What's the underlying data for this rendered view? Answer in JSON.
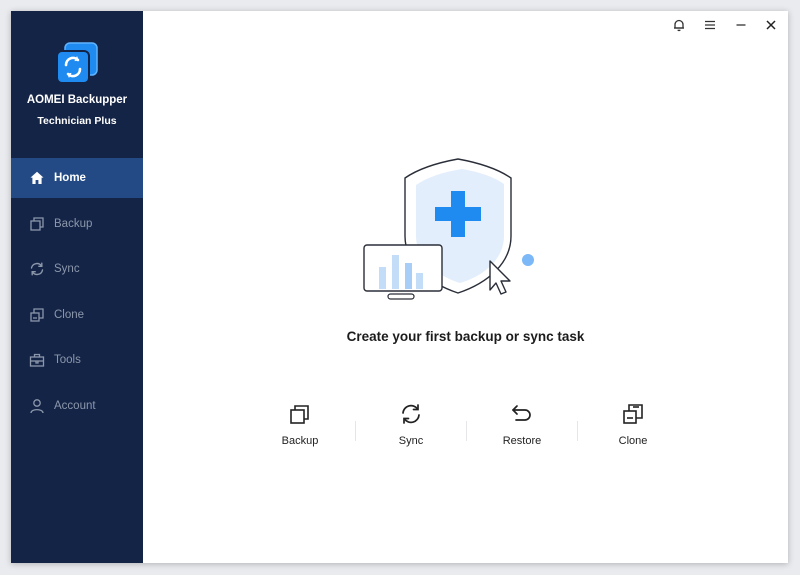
{
  "app": {
    "name": "AOMEI Backupper",
    "edition": "Technician Plus"
  },
  "sidebar": {
    "items": [
      {
        "label": "Home",
        "icon": "home-icon",
        "active": true
      },
      {
        "label": "Backup",
        "icon": "backup-icon",
        "active": false
      },
      {
        "label": "Sync",
        "icon": "sync-icon",
        "active": false
      },
      {
        "label": "Clone",
        "icon": "clone-icon",
        "active": false
      },
      {
        "label": "Tools",
        "icon": "tools-icon",
        "active": false
      },
      {
        "label": "Account",
        "icon": "account-icon",
        "active": false
      }
    ]
  },
  "titlebar": {
    "icons": [
      "bell-icon",
      "menu-icon",
      "minimize-icon",
      "close-icon"
    ]
  },
  "main": {
    "headline": "Create your first backup or sync task",
    "actions": [
      {
        "label": "Backup",
        "icon": "backup-icon"
      },
      {
        "label": "Sync",
        "icon": "sync-icon"
      },
      {
        "label": "Restore",
        "icon": "restore-icon"
      },
      {
        "label": "Clone",
        "icon": "clone-icon"
      }
    ]
  },
  "colors": {
    "sidebar_bg": "#142446",
    "sidebar_active": "#234a85",
    "accent": "#1f8bf0"
  }
}
